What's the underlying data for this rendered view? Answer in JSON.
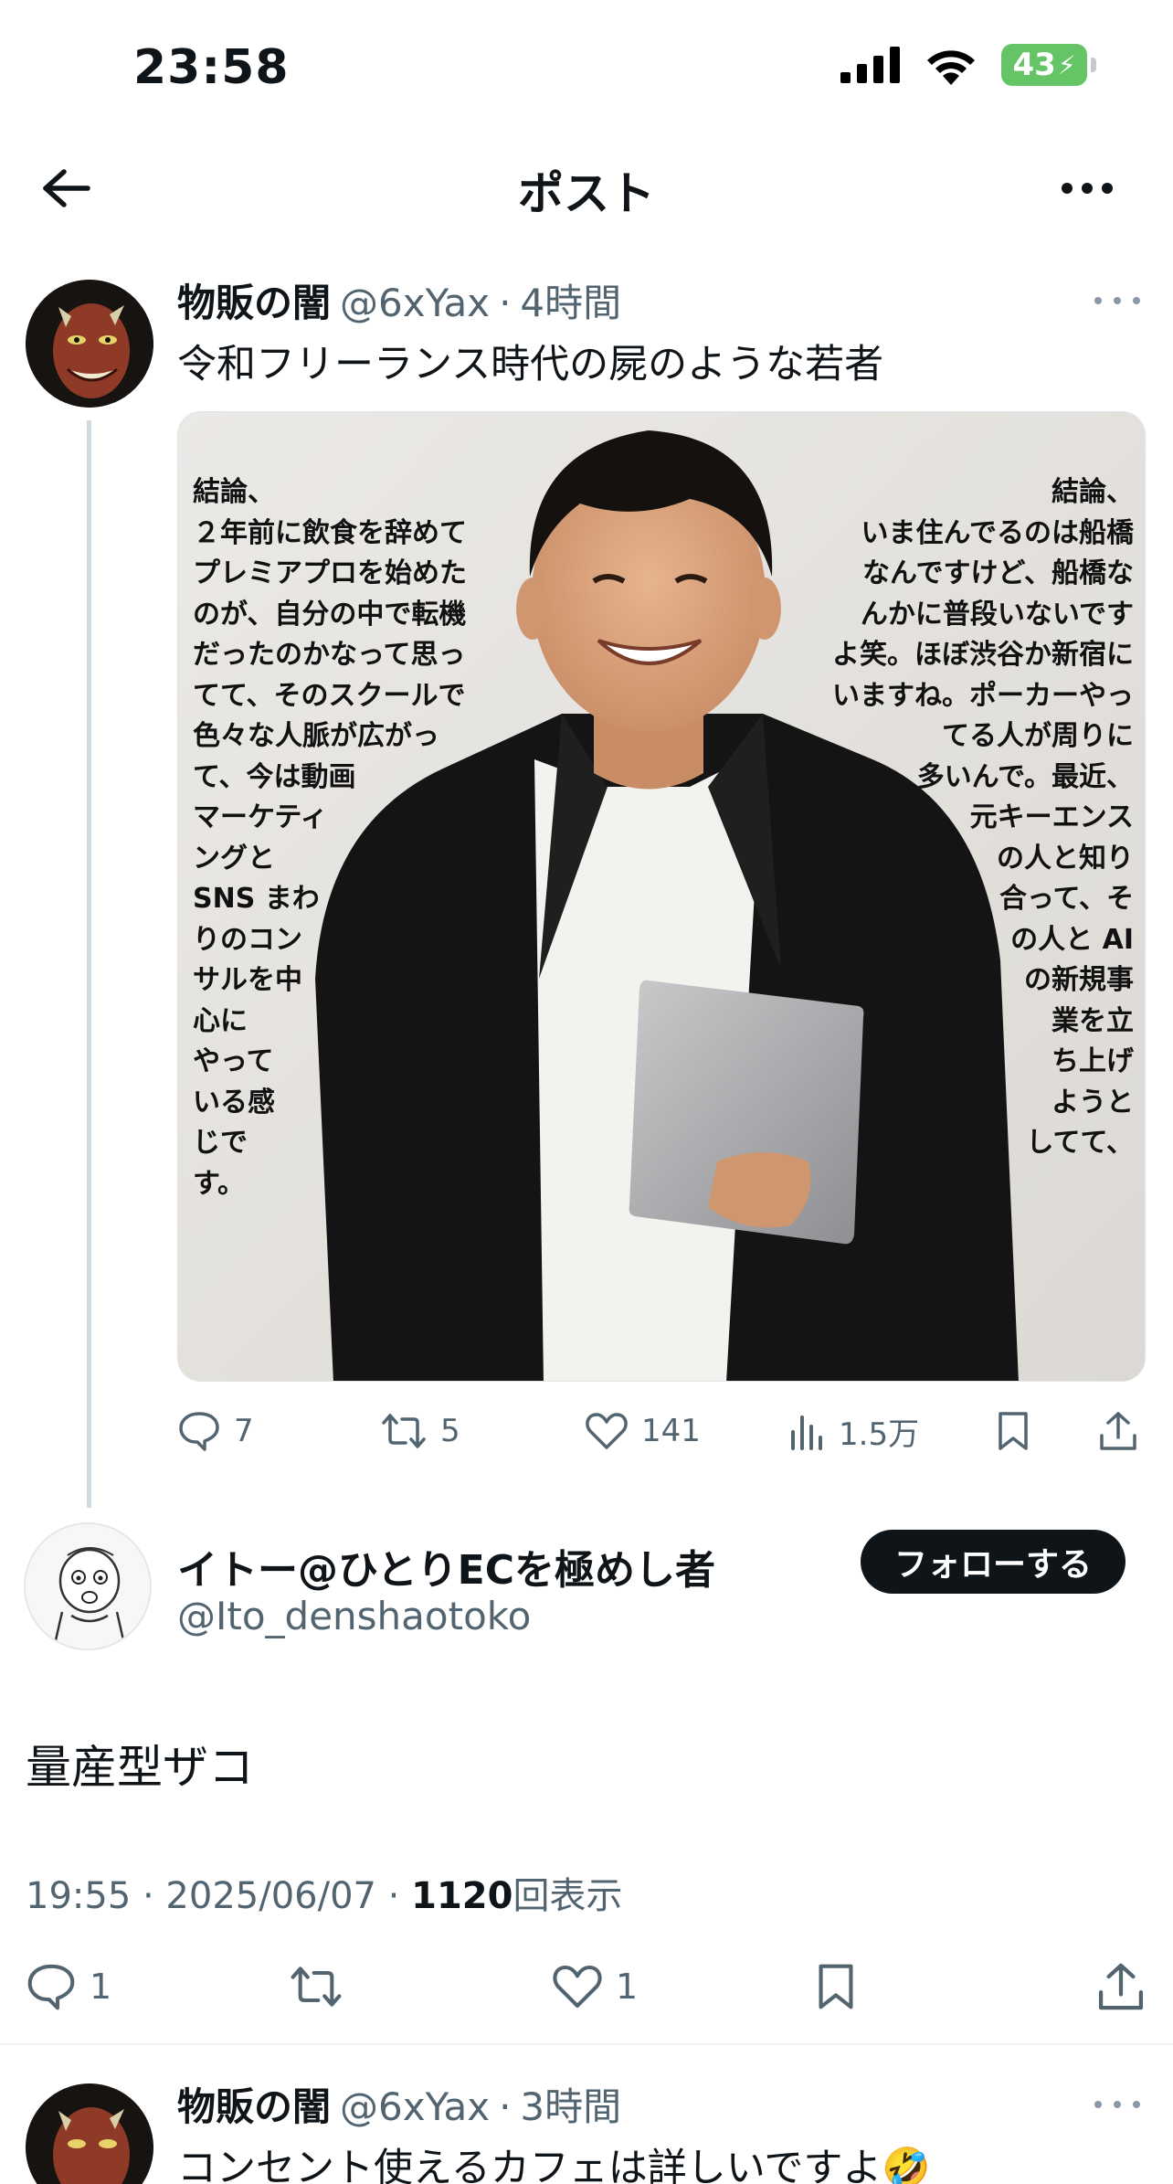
{
  "status_bar": {
    "time": "23:58",
    "battery": "43"
  },
  "header": {
    "title": "ポスト"
  },
  "parent_tweet": {
    "display_name": "物販の闇",
    "handle": "@6xYax",
    "separator": "·",
    "time_ago": "4時間",
    "text": "令和フリーランス時代の屍のような若者",
    "image_text_left": "結論、\n２年前に飲食を辞めて\nプレミアプロを始めた\nのが、自分の中で転機\nだったのかなって思っ\nてて、そのスクールで\n色々な人脈が広がっ\nて、今は動画\nマーケティ\nングと\nSNS まわ\nりのコン\nサルを中\n心に\nやって\nいる感\nじで\nす。",
    "image_text_right": "結論、\nいま住んでるのは船橋\nなんですけど、船橋な\nんかに普段いないです\nよ笑。ほぼ渋谷か新宿に\nいますね。ポーカーやっ\nてる人が周りに\n多いんで。最近、\n元キーエンス\nの人と知り\n合って、そ\nの人と AI\nの新規事\n業を立\nち上げ\nようと\nしてて、",
    "replies": "7",
    "reposts": "5",
    "likes": "141",
    "views": "1.5万"
  },
  "reply_tweet": {
    "display_name": "イトー@ひとりECを極めし者",
    "handle": "@Ito_denshaotoko",
    "follow_label": "フォローする",
    "text": "量産型ザコ",
    "timestamp": "19:55 · 2025/06/07 · ",
    "view_count": "1120",
    "view_label": "回表示",
    "replies": "1",
    "likes": "1"
  },
  "next_tweet": {
    "display_name": "物販の闇",
    "handle": "@6xYax",
    "separator": "·",
    "time_ago": "3時間",
    "text": "コンセント使えるカフェは詳しいですよ🤣"
  }
}
